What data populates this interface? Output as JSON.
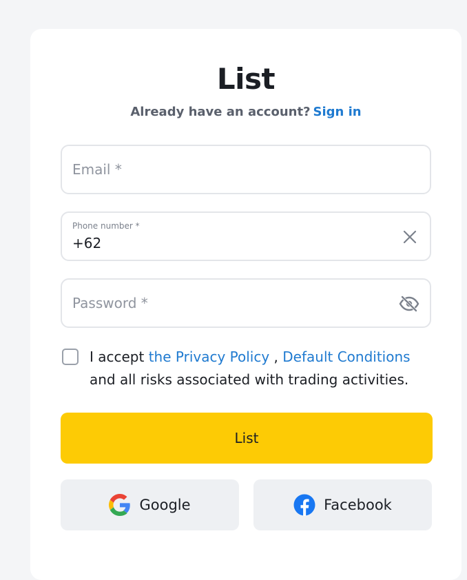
{
  "form": {
    "title": "List",
    "subtitle_text": "Already have an account?",
    "signin_link": "Sign in",
    "email": {
      "placeholder": "Email *",
      "value": ""
    },
    "phone": {
      "label": "Phone number *",
      "value": "+62"
    },
    "password": {
      "placeholder": "Password *",
      "value": ""
    },
    "consent": {
      "checked": false,
      "prefix": "I accept ",
      "privacy_link": "the Privacy Policy",
      "separator": " , ",
      "conditions_link": "Default Conditions",
      "suffix": " and all risks associated with trading activities."
    },
    "submit_label": "List",
    "social": {
      "google_label": "Google",
      "facebook_label": "Facebook"
    }
  },
  "colors": {
    "accent_yellow": "#fdcb05",
    "link_blue": "#1f7ad0",
    "facebook_blue": "#1877f2"
  },
  "icons": {
    "phone_clear": "close-icon",
    "password_toggle": "eye-off-icon",
    "google": "google-icon",
    "facebook": "facebook-icon"
  }
}
